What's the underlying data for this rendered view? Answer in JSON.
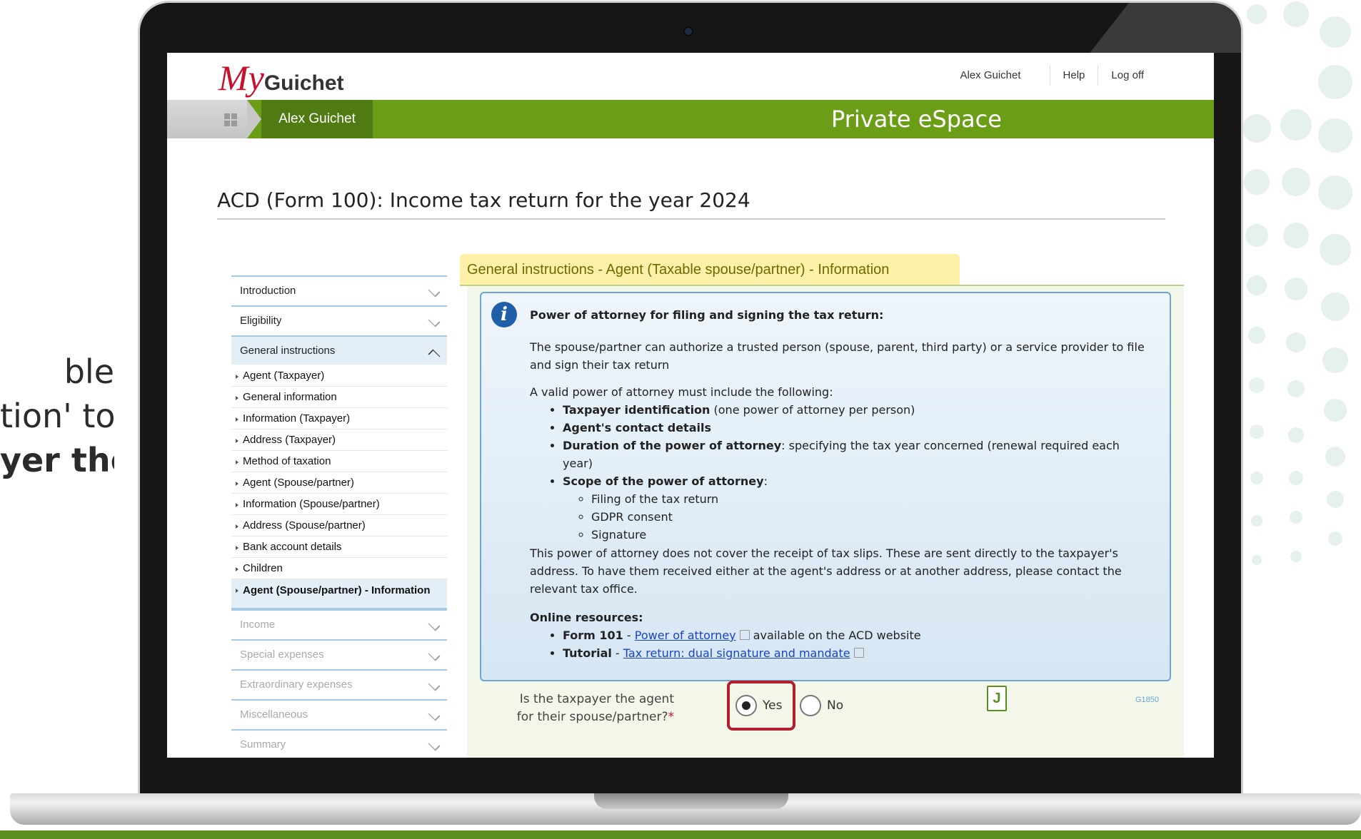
{
  "side_caption": {
    "line1": "ble",
    "line2": "tion' to",
    "line3": "yer the"
  },
  "header": {
    "logo_my": "My",
    "logo_rest": "Guichet",
    "user": "Alex Guichet",
    "help": "Help",
    "logoff": "Log off"
  },
  "banner": {
    "user_tab": "Alex Guichet",
    "title": "Private eSpace"
  },
  "page": {
    "title": "ACD (Form 100): Income tax return for the year 2024"
  },
  "nav": {
    "introduction": "Introduction",
    "eligibility": "Eligibility",
    "general_instructions": "General instructions",
    "subitems": [
      "Agent (Taxpayer)",
      "General information",
      "Information (Taxpayer)",
      "Address (Taxpayer)",
      "Method of taxation",
      "Agent (Spouse/partner)",
      "Information (Spouse/partner)",
      "Address (Spouse/partner)",
      "Bank account details",
      "Children",
      "Agent (Spouse/partner) - Information"
    ],
    "income": "Income",
    "special_expenses": "Special expenses",
    "extraordinary_expenses": "Extraordinary expenses",
    "miscellaneous": "Miscellaneous",
    "summary": "Summary"
  },
  "section": {
    "header": "General instructions - Agent (Taxable spouse/partner) - Information"
  },
  "info": {
    "heading": "Power of attorney for filing and signing the tax return:",
    "p1": "The spouse/partner can authorize a trusted person (spouse, parent, third party) or a service provider to file and sign their tax return",
    "p2": "A valid power of attorney must include the following:",
    "b1_bold": "Taxpayer identification",
    "b1_rest": " (one power of attorney per person)",
    "b2_bold": "Agent's contact details",
    "b3_bold": "Duration of the power of attorney",
    "b3_rest": ": specifying the tax year concerned (renewal required each year)",
    "b4_bold": "Scope of the power of attorney",
    "b4_rest": ":",
    "sub1": "Filing of the tax return",
    "sub2": "GDPR consent",
    "sub3": "Signature",
    "p3": "This power of attorney does not cover the receipt of tax slips. These are sent directly to the taxpayer's address. To have them received either at the agent's address or at another address, please contact the relevant tax office.",
    "resources_heading": "Online resources:",
    "r1_bold": "Form 101",
    "r1_sep": " - ",
    "r1_link": "Power of attorney",
    "r1_rest": " available on the ACD website",
    "r2_bold": "Tutorial",
    "r2_sep": " - ",
    "r2_link": "Tax return: dual signature and mandate"
  },
  "question": {
    "text": "Is the taxpayer the agent for their spouse/partner?",
    "required_mark": "*",
    "yes": "Yes",
    "no": "No",
    "selected": "Yes",
    "code": "G1850",
    "doc_glyph": "J"
  },
  "colors": {
    "brand_green": "#6b9e16",
    "brand_red": "#c8102e",
    "highlight": "#b21f2d"
  }
}
